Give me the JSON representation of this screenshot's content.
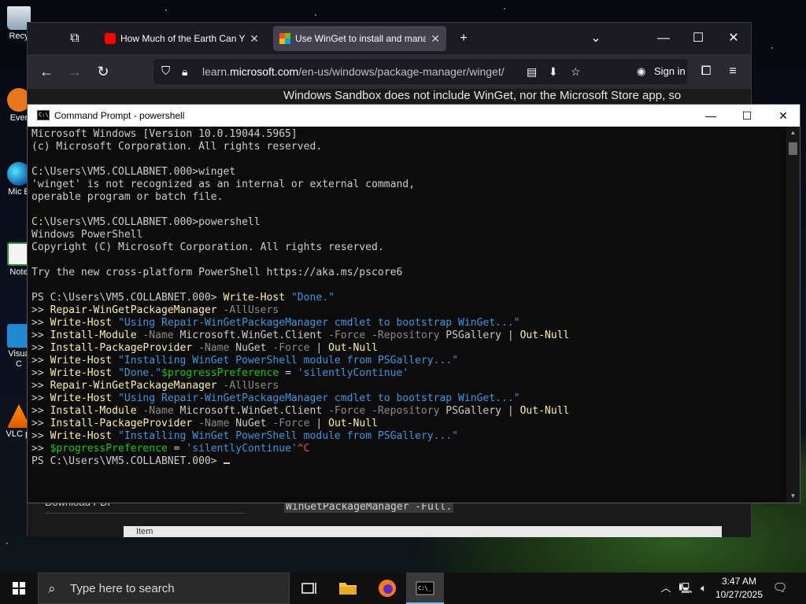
{
  "desktop": {
    "icons": [
      {
        "label": "Recy"
      },
      {
        "label": "Ever"
      },
      {
        "label": "Mic E"
      },
      {
        "label": "Note"
      },
      {
        "label": "Visua C"
      },
      {
        "label": "VLC pl"
      }
    ]
  },
  "browser": {
    "tabs": [
      {
        "title": "How Much of the Earth Can You",
        "active": false
      },
      {
        "title": "Use WinGet to install and mana",
        "active": true
      }
    ],
    "new_tab_label": "+",
    "url_path_pre": "learn.",
    "url_host": "microsoft.com",
    "url_path": "/en-us/windows/package-manager/winget/",
    "sign_in_label": "Sign in",
    "page_text_top": "Windows Sandbox does not include WinGet, nor the Microsoft Store app, so",
    "page_text_bottom": "WinGetPackageManager -Full.",
    "page_left_link": "Download PDF",
    "page_footer_frag": "Item"
  },
  "cmd": {
    "title": "Command Prompt - powershell",
    "icon_text": "C:\\_",
    "lines": [
      [
        {
          "c": "def",
          "t": "Microsoft Windows [Version 10.0.19044.5965]"
        }
      ],
      [
        {
          "c": "def",
          "t": "(c) Microsoft Corporation. All rights reserved."
        }
      ],
      [
        {
          "c": "def",
          "t": ""
        }
      ],
      [
        {
          "c": "def",
          "t": "C:\\Users\\VM5.COLLABNET.000>winget"
        }
      ],
      [
        {
          "c": "def",
          "t": "'winget' is not recognized as an internal or external command,"
        }
      ],
      [
        {
          "c": "def",
          "t": "operable program or batch file."
        }
      ],
      [
        {
          "c": "def",
          "t": ""
        }
      ],
      [
        {
          "c": "def",
          "t": "C:\\Users\\VM5.COLLABNET.000>powershell"
        }
      ],
      [
        {
          "c": "def",
          "t": "Windows PowerShell"
        }
      ],
      [
        {
          "c": "def",
          "t": "Copyright (C) Microsoft Corporation. All rights reserved."
        }
      ],
      [
        {
          "c": "def",
          "t": ""
        }
      ],
      [
        {
          "c": "def",
          "t": "Try the new cross-platform PowerShell https://aka.ms/pscore6"
        }
      ],
      [
        {
          "c": "def",
          "t": ""
        }
      ],
      [
        {
          "c": "def",
          "t": "PS C:\\Users\\VM5.COLLABNET.000> "
        },
        {
          "c": "y",
          "t": "Write-Host"
        },
        {
          "c": "def",
          "t": " "
        },
        {
          "c": "s",
          "t": "\"Done.\""
        }
      ],
      [
        {
          "c": "def",
          "t": ">> "
        },
        {
          "c": "y",
          "t": "Repair-WinGetPackageManager"
        },
        {
          "c": "def",
          "t": " "
        },
        {
          "c": "p",
          "t": "-AllUsers"
        }
      ],
      [
        {
          "c": "def",
          "t": ">> "
        },
        {
          "c": "y",
          "t": "Write-Host"
        },
        {
          "c": "def",
          "t": " "
        },
        {
          "c": "s",
          "t": "\"Using Repair-WinGetPackageManager cmdlet to bootstrap WinGet...\""
        }
      ],
      [
        {
          "c": "def",
          "t": ">> "
        },
        {
          "c": "y",
          "t": "Install-Module"
        },
        {
          "c": "def",
          "t": " "
        },
        {
          "c": "p",
          "t": "-Name"
        },
        {
          "c": "def",
          "t": " Microsoft.WinGet.Client "
        },
        {
          "c": "p",
          "t": "-Force -Repository"
        },
        {
          "c": "def",
          "t": " PSGallery | "
        },
        {
          "c": "y",
          "t": "Out-Null"
        }
      ],
      [
        {
          "c": "def",
          "t": ">> "
        },
        {
          "c": "y",
          "t": "Install-PackageProvider"
        },
        {
          "c": "def",
          "t": " "
        },
        {
          "c": "p",
          "t": "-Name"
        },
        {
          "c": "def",
          "t": " NuGet "
        },
        {
          "c": "p",
          "t": "-Force"
        },
        {
          "c": "def",
          "t": " | "
        },
        {
          "c": "y",
          "t": "Out-Null"
        }
      ],
      [
        {
          "c": "def",
          "t": ">> "
        },
        {
          "c": "y",
          "t": "Write-Host"
        },
        {
          "c": "def",
          "t": " "
        },
        {
          "c": "s",
          "t": "\"Installing WinGet PowerShell module from PSGallery...\""
        }
      ],
      [
        {
          "c": "def",
          "t": ">> "
        },
        {
          "c": "y",
          "t": "Write-Host"
        },
        {
          "c": "def",
          "t": " "
        },
        {
          "c": "s",
          "t": "\"Done.\""
        },
        {
          "c": "v",
          "t": "$progressPreference"
        },
        {
          "c": "def",
          "t": " = "
        },
        {
          "c": "s",
          "t": "'silentlyContinue'"
        }
      ],
      [
        {
          "c": "def",
          "t": ">> "
        },
        {
          "c": "y",
          "t": "Repair-WinGetPackageManager"
        },
        {
          "c": "def",
          "t": " "
        },
        {
          "c": "p",
          "t": "-AllUsers"
        }
      ],
      [
        {
          "c": "def",
          "t": ">> "
        },
        {
          "c": "y",
          "t": "Write-Host"
        },
        {
          "c": "def",
          "t": " "
        },
        {
          "c": "s",
          "t": "\"Using Repair-WinGetPackageManager cmdlet to bootstrap WinGet...\""
        }
      ],
      [
        {
          "c": "def",
          "t": ">> "
        },
        {
          "c": "y",
          "t": "Install-Module"
        },
        {
          "c": "def",
          "t": " "
        },
        {
          "c": "p",
          "t": "-Name"
        },
        {
          "c": "def",
          "t": " Microsoft.WinGet.Client "
        },
        {
          "c": "p",
          "t": "-Force -Repository"
        },
        {
          "c": "def",
          "t": " PSGallery | "
        },
        {
          "c": "y",
          "t": "Out-Null"
        }
      ],
      [
        {
          "c": "def",
          "t": ">> "
        },
        {
          "c": "y",
          "t": "Install-PackageProvider"
        },
        {
          "c": "def",
          "t": " "
        },
        {
          "c": "p",
          "t": "-Name"
        },
        {
          "c": "def",
          "t": " NuGet "
        },
        {
          "c": "p",
          "t": "-Force"
        },
        {
          "c": "def",
          "t": " | "
        },
        {
          "c": "y",
          "t": "Out-Null"
        }
      ],
      [
        {
          "c": "def",
          "t": ">> "
        },
        {
          "c": "y",
          "t": "Write-Host"
        },
        {
          "c": "def",
          "t": " "
        },
        {
          "c": "s",
          "t": "\"Installing WinGet PowerShell module from PSGallery...\""
        }
      ],
      [
        {
          "c": "def",
          "t": ">> "
        },
        {
          "c": "v",
          "t": "$progressPreference"
        },
        {
          "c": "def",
          "t": " = "
        },
        {
          "c": "s",
          "t": "'silentlyContinue'"
        },
        {
          "c": "r",
          "t": "^C"
        }
      ],
      [
        {
          "c": "def",
          "t": "PS C:\\Users\\VM5.COLLABNET.000> "
        }
      ]
    ]
  },
  "taskbar": {
    "search_placeholder": "Type here to search",
    "time": "3:47 AM",
    "date": "10/27/2025"
  },
  "colors": {
    "console_bg": "#0c0c0c",
    "console_text": "#cccccc",
    "ps_command": "#f9f1a5",
    "ps_param": "#8a8a8a",
    "ps_string": "#3a96dd",
    "ps_variable": "#16c60c",
    "ps_ctrlc": "#e74856",
    "browser_chrome": "#2b2a33"
  }
}
